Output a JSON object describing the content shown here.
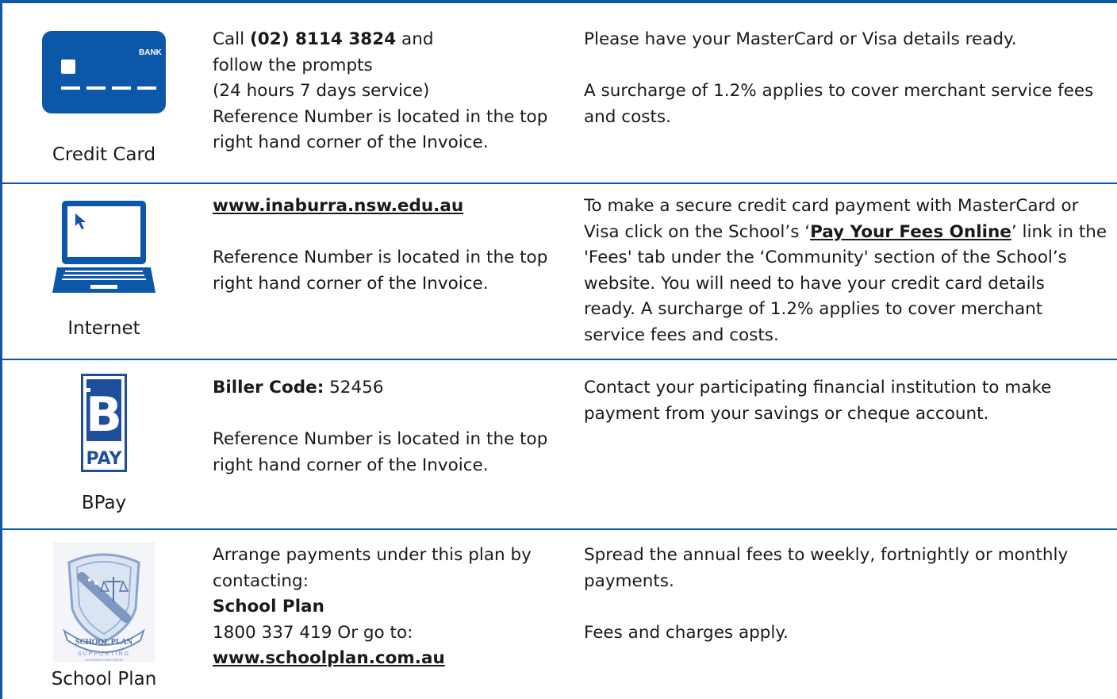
{
  "rows": [
    {
      "method": "Credit Card",
      "icon": "credit-card-icon",
      "icon_text": "BANK",
      "details": {
        "call_prefix": "Call ",
        "phone": "(02) 8114 3824",
        "call_suffix": " and",
        "line2": "follow the prompts",
        "line3": "(24 hours 7 days service)",
        "line4": "Reference Number is located in the top",
        "line5": "right hand corner of the Invoice."
      },
      "notes": {
        "line1": "Please have your MasterCard or Visa details ready.",
        "line2a": "A surcharge of 1.2% applies to cover merchant service fees",
        "line2b": "and costs."
      }
    },
    {
      "method": "Internet",
      "icon": "laptop-icon",
      "details": {
        "link": "www.inaburra.nsw.edu.au",
        "line2": "Reference Number is located in the top",
        "line3": "right hand corner of the Invoice."
      },
      "notes": {
        "l1": "To make a secure credit card payment with MasterCard or",
        "l2a": "Visa click on the School’s ‘",
        "l2link": "Pay Your Fees Online",
        "l2b": "’ link in the",
        "l3": "'Fees' tab under the ‘Community' section of the School’s",
        "l4": "website. You will need to have your credit card details",
        "l5": "ready. A surcharge of 1.2% applies to cover merchant",
        "l6": "service fees and costs."
      }
    },
    {
      "method": "BPay",
      "icon": "bpay-logo-icon",
      "icon_text_top": "B",
      "icon_text_bottom": "PAY",
      "details": {
        "biller_label": "Biller Code:",
        "biller_code": " 52456",
        "line2": "Reference Number is located in the top",
        "line3": "right hand corner of the Invoice."
      },
      "notes": {
        "l1": "Contact your participating financial institution to make",
        "l2": "payment from your savings or cheque account."
      }
    },
    {
      "method": "School Plan",
      "icon": "school-plan-crest-icon",
      "icon_text_banner": "SCHOOL PLAN",
      "icon_text_tagline": "SUPPORTING",
      "icon_text_tagline2": "CHILDREN'S EDUCATION",
      "details": {
        "l1": "Arrange payments under this plan by",
        "l2": "contacting:",
        "l3": "School Plan",
        "l4": "1800 337 419 Or go to:",
        "link": "www.schoolplan.com.au"
      },
      "notes": {
        "l1": "Spread the annual fees to weekly, fortnightly or monthly",
        "l2": "payments.",
        "l3": "Fees and charges apply."
      }
    }
  ],
  "colors": {
    "brand_blue": "#0d57a8",
    "bpay_blue": "#1f4e9c"
  }
}
